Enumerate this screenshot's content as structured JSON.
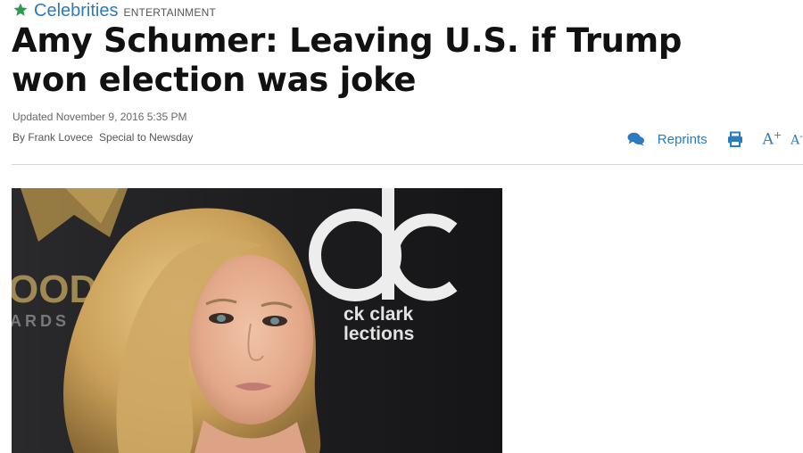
{
  "article": {
    "section": "Celebrities",
    "section_tag": "ENTERTAINMENT",
    "headline": "Amy Schumer: Leaving U.S. if Trump won election was joke",
    "updated": "Updated November 9, 2016 5:35 PM",
    "author": "By Frank Lovece",
    "affiliation": "Special to Newsday"
  },
  "tools": {
    "reprints_label": "Reprints",
    "font_up_label": "A",
    "font_up_sup": "+",
    "font_down_label": "A",
    "font_down_sup": "-"
  },
  "photo": {
    "backdrop_text_left_top": "OOD",
    "backdrop_text_left_bottom": "ARDS",
    "logo_text_main": "dc",
    "logo_text_sub1": "ck clark",
    "logo_text_sub2": "lections"
  },
  "colors": {
    "accent": "#2b7bbf",
    "star": "#2e9a52",
    "headline": "#111111"
  },
  "icons": [
    "star-icon",
    "comments-icon",
    "print-icon"
  ]
}
